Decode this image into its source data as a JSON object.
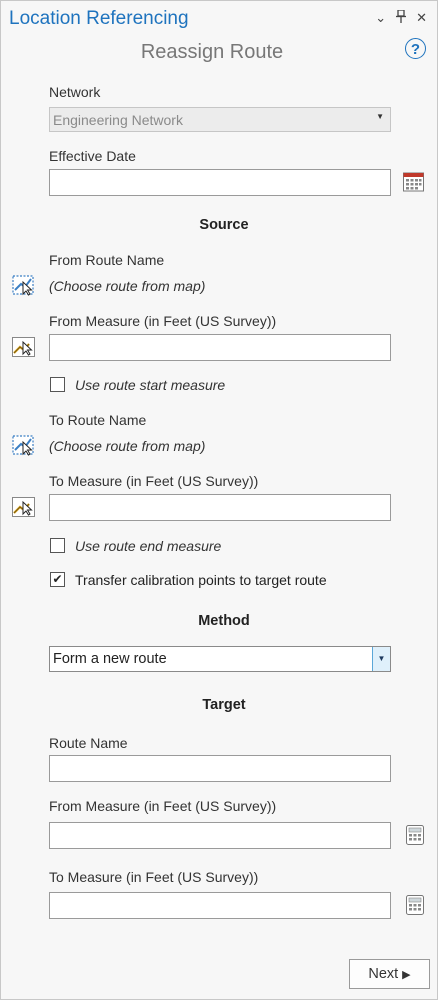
{
  "header": {
    "pane_title": "Location Referencing",
    "icons": [
      "chevron-down-icon",
      "pin-icon",
      "close-icon"
    ],
    "tool_title": "Reassign Route",
    "help": "?"
  },
  "network": {
    "label": "Network",
    "value": "Engineering Network"
  },
  "effective_date": {
    "label": "Effective Date",
    "value": ""
  },
  "source": {
    "heading": "Source",
    "from_route_label": "From Route Name",
    "from_route_placeholder": "(Choose route from map)",
    "from_measure_label": "From Measure (in Feet (US Survey))",
    "from_measure_value": "",
    "use_start_label": "Use route start measure",
    "use_start_checked": false,
    "to_route_label": "To Route Name",
    "to_route_placeholder": "(Choose route from map)",
    "to_measure_label": "To Measure (in Feet (US Survey))",
    "to_measure_value": "",
    "use_end_label": "Use route end measure",
    "use_end_checked": false,
    "transfer_label": "Transfer calibration points to target route",
    "transfer_checked": true,
    "check_glyph": "✔"
  },
  "method": {
    "heading": "Method",
    "value": "Form a new route"
  },
  "target": {
    "heading": "Target",
    "route_name_label": "Route Name",
    "route_name_value": "",
    "from_measure_label": "From Measure (in Feet (US Survey))",
    "from_measure_value": "",
    "to_measure_label": "To Measure (in Feet (US Survey))",
    "to_measure_value": ""
  },
  "footer": {
    "next_label": "Next",
    "next_arrow": "▶"
  },
  "colors": {
    "accent": "#1e73be",
    "pane_bg": "#f7f7f7",
    "dropdown_button": "#dff0fb"
  }
}
